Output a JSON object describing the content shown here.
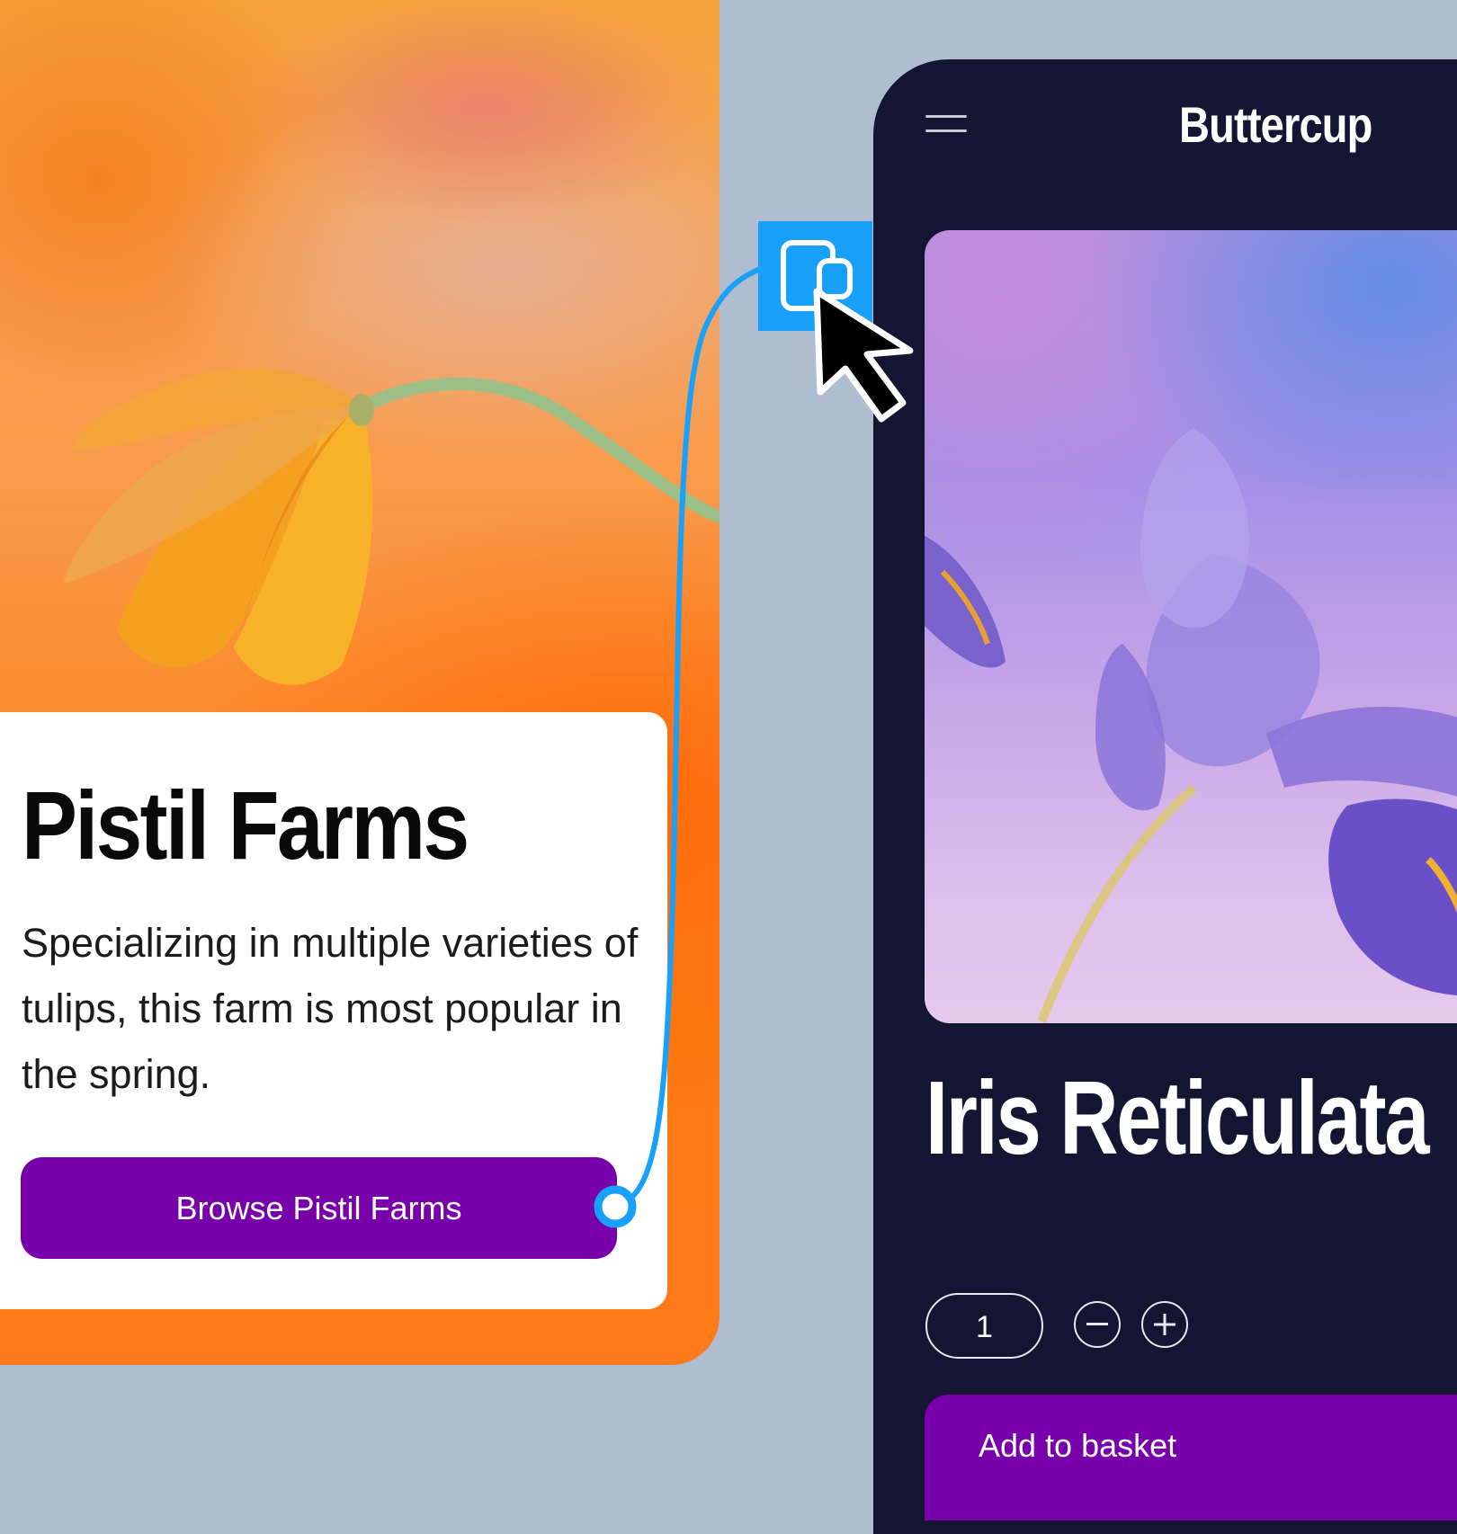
{
  "left_card": {
    "title": "Pistil Farms",
    "description": "Specializing in multiple varieties of tulips, this farm is most popular in the spring.",
    "button_label": "Browse Pistil Farms"
  },
  "phone": {
    "brand": "Buttercup",
    "product_title": "Iris Reticulata",
    "quantity": "1",
    "add_button_label": "Add to basket"
  },
  "icons": {
    "menu": "hamburger-menu-icon",
    "decrement": "minus-icon",
    "increment": "plus-icon",
    "component": "component-instance-icon",
    "cursor": "arrow-cursor-icon"
  },
  "colors": {
    "background": "#b0bccf",
    "accent_purple": "#7700ab",
    "phone_bg": "#131532",
    "connector_blue": "#18a0fb"
  }
}
